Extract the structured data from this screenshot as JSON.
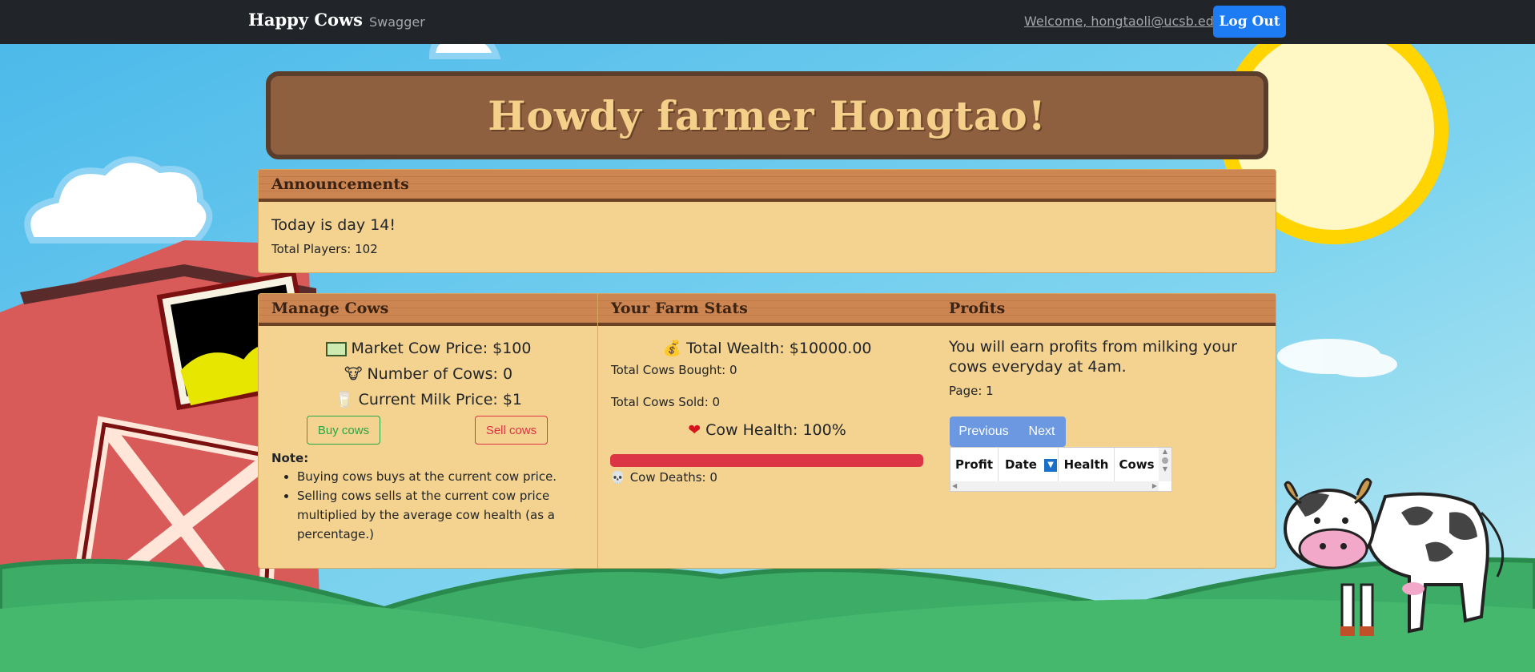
{
  "navbar": {
    "brand": "Happy Cows",
    "swagger_link": "Swagger",
    "welcome_text": "Welcome, hongtaoli@ucsb.edu",
    "logout_label": "Log Out"
  },
  "banner": {
    "title": "Howdy farmer Hongtao!"
  },
  "announcements": {
    "header": "Announcements",
    "day_text": "Today is day 14!",
    "players_text": "Total Players: 102"
  },
  "manage_cows": {
    "header": "Manage Cows",
    "market_price": "Market Cow Price: $100",
    "num_cows": "Number of Cows: 0",
    "milk_price": "Current Milk Price: $1",
    "buy_label": "Buy cows",
    "sell_label": "Sell cows",
    "note_label": "Note:",
    "notes": [
      "Buying cows buys at the current cow price.",
      "Selling cows sells at the current cow price multiplied by the average cow health (as a percentage.)"
    ]
  },
  "farm_stats": {
    "header": "Your Farm Stats",
    "total_wealth": "Total Wealth: $10000.00",
    "cows_bought": "Total Cows Bought: 0",
    "cows_sold": "Total Cows Sold: 0",
    "cow_health": "Cow Health: 100%",
    "cow_health_value": 100,
    "cow_deaths": "Cow Deaths: 0"
  },
  "profits": {
    "header": "Profits",
    "description": "You will earn profits from milking your cows everyday at 4am.",
    "page_text": "Page: 1",
    "prev_label": "Previous",
    "next_label": "Next",
    "columns": [
      "Profit",
      "Date",
      "Health",
      "Cows"
    ]
  },
  "colors": {
    "navbar": "#212529",
    "card_bg": "#f4d28f",
    "card_header": "#cd8651",
    "buy_green": "#28a745",
    "sell_red": "#dc3545",
    "health_bar": "#dc3545",
    "pager_blue": "#6b98e0"
  }
}
